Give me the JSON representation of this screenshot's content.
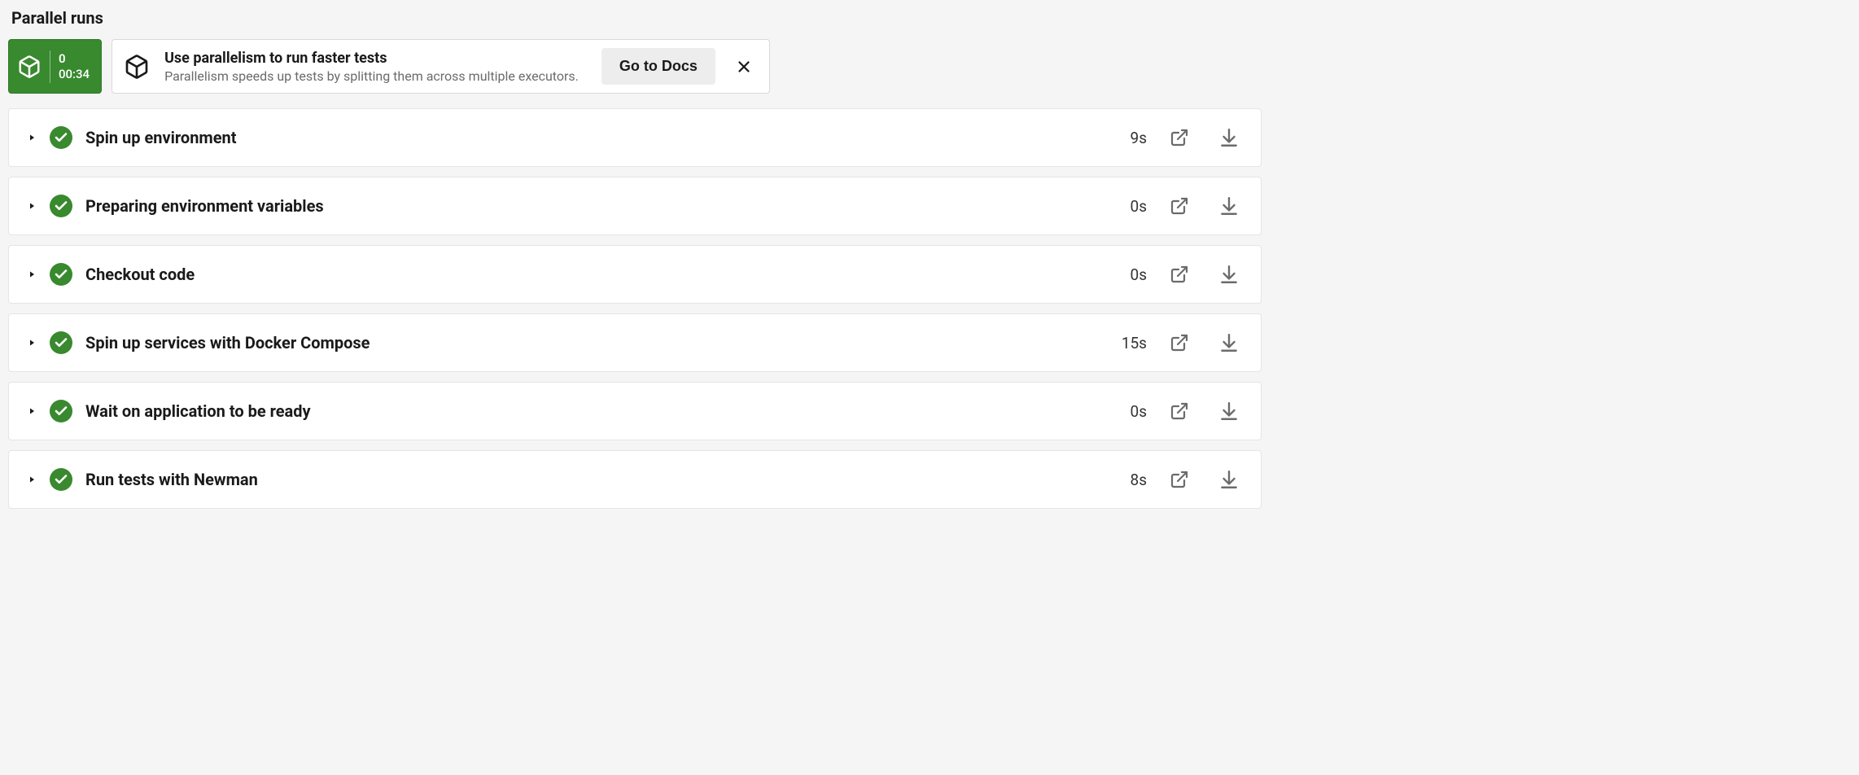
{
  "section_title": "Parallel runs",
  "run_badge": {
    "index": "0",
    "time": "00:34"
  },
  "tip": {
    "title": "Use parallelism to run faster tests",
    "subtitle": "Parallelism speeds up tests by splitting them across multiple executors.",
    "button_label": "Go to Docs"
  },
  "steps": [
    {
      "title": "Spin up environment",
      "duration": "9s"
    },
    {
      "title": "Preparing environment variables",
      "duration": "0s"
    },
    {
      "title": "Checkout code",
      "duration": "0s"
    },
    {
      "title": "Spin up services with Docker Compose",
      "duration": "15s"
    },
    {
      "title": "Wait on application to be ready",
      "duration": "0s"
    },
    {
      "title": "Run tests with Newman",
      "duration": "8s"
    }
  ]
}
